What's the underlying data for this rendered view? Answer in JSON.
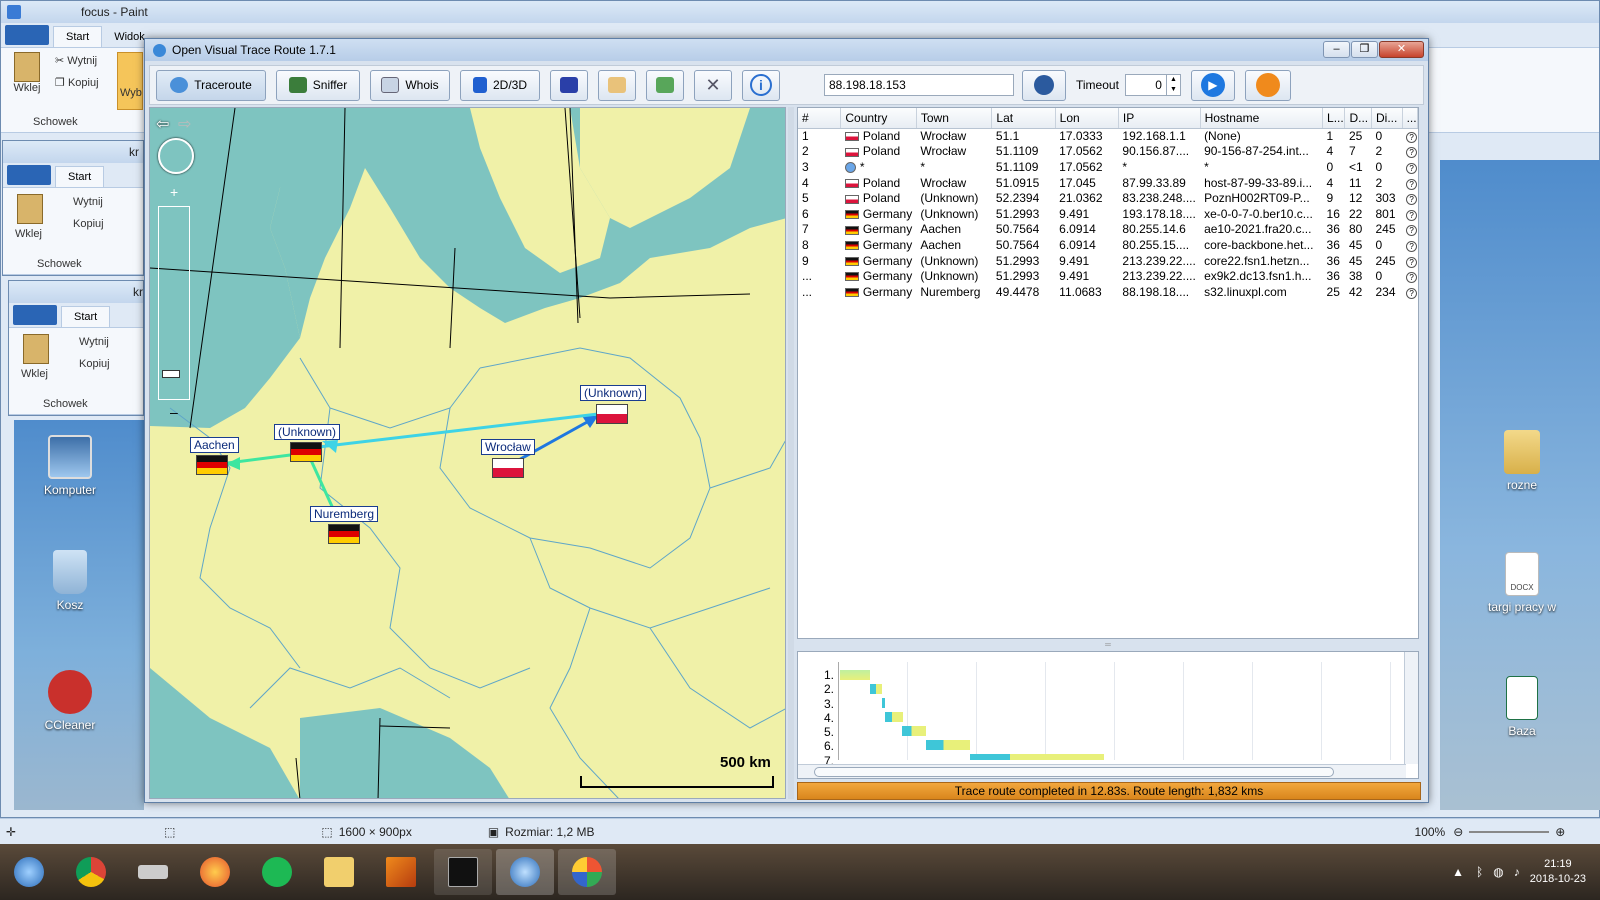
{
  "paint_window": {
    "title": "focus - Paint",
    "tabs": [
      "Start",
      "Widok"
    ],
    "clipboard": {
      "paste": "Wklej",
      "cut": "Wytnij",
      "copy": "Kopiuj",
      "group": "Schowek",
      "select": "Wyb"
    },
    "bg_title_fragment": "kr",
    "status_dimensions": "1600 × 900px",
    "status_size": "Rozmiar: 1,2 MB",
    "zoom": "100%"
  },
  "desktop_icons": [
    {
      "label": "Komputer",
      "icon": "computer-icon"
    },
    {
      "label": "Kosz",
      "icon": "recycle-bin-icon"
    },
    {
      "label": "CCleaner",
      "icon": "ccleaner-icon"
    },
    {
      "label": "rozne",
      "icon": "folder-icon"
    },
    {
      "label": "targi pracy w",
      "icon": "docx-file-icon"
    },
    {
      "label": "Baza",
      "icon": "excel-file-icon"
    }
  ],
  "docx_badge": "DOCX",
  "app": {
    "title": "Open Visual Trace Route 1.7.1",
    "toolbar": {
      "traceroute": "Traceroute",
      "sniffer": "Sniffer",
      "whois": "Whois",
      "view": "2D/3D",
      "ip_value": "88.198.18.153",
      "timeout_label": "Timeout",
      "timeout_value": "0"
    },
    "map": {
      "labels": [
        "(Unknown)",
        "Aachen",
        "(Unknown)",
        "Wrocław",
        "Nuremberg"
      ],
      "scale": "500 km",
      "zoom_plus": "+",
      "zoom_minus": "–"
    },
    "table": {
      "headers": [
        "#",
        "Country",
        "Town",
        "Lat",
        "Lon",
        "IP",
        "Hostname",
        "L...",
        "D...",
        "Di...",
        "..."
      ],
      "rows": [
        {
          "n": "1",
          "flag": "pl",
          "country": "Poland",
          "town": "Wrocław",
          "lat": "51.1",
          "lon": "17.0333",
          "ip": "192.168.1.1",
          "host": "(None)",
          "l": "1",
          "d": "25",
          "di": "0"
        },
        {
          "n": "2",
          "flag": "pl",
          "country": "Poland",
          "town": "Wrocław",
          "lat": "51.1109",
          "lon": "17.0562",
          "ip": "90.156.87....",
          "host": "90-156-87-254.int...",
          "l": "4",
          "d": "7",
          "di": "2"
        },
        {
          "n": "3",
          "flag": "uk",
          "country": "*",
          "town": "*",
          "lat": "51.1109",
          "lon": "17.0562",
          "ip": "*",
          "host": "*",
          "l": "0",
          "d": "<1",
          "di": "0"
        },
        {
          "n": "4",
          "flag": "pl",
          "country": "Poland",
          "town": "Wrocław",
          "lat": "51.0915",
          "lon": "17.045",
          "ip": "87.99.33.89",
          "host": "host-87-99-33-89.i...",
          "l": "4",
          "d": "11",
          "di": "2"
        },
        {
          "n": "5",
          "flag": "pl",
          "country": "Poland",
          "town": "(Unknown)",
          "lat": "52.2394",
          "lon": "21.0362",
          "ip": "83.238.248....",
          "host": "PoznH002RT09-P...",
          "l": "9",
          "d": "12",
          "di": "303"
        },
        {
          "n": "6",
          "flag": "de",
          "country": "Germany",
          "town": "(Unknown)",
          "lat": "51.2993",
          "lon": "9.491",
          "ip": "193.178.18....",
          "host": "xe-0-0-7-0.ber10.c...",
          "l": "16",
          "d": "22",
          "di": "801"
        },
        {
          "n": "7",
          "flag": "de",
          "country": "Germany",
          "town": "Aachen",
          "lat": "50.7564",
          "lon": "6.0914",
          "ip": "80.255.14.6",
          "host": "ae10-2021.fra20.c...",
          "l": "36",
          "d": "80",
          "di": "245"
        },
        {
          "n": "8",
          "flag": "de",
          "country": "Germany",
          "town": "Aachen",
          "lat": "50.7564",
          "lon": "6.0914",
          "ip": "80.255.15....",
          "host": "core-backbone.het...",
          "l": "36",
          "d": "45",
          "di": "0"
        },
        {
          "n": "9",
          "flag": "de",
          "country": "Germany",
          "town": "(Unknown)",
          "lat": "51.2993",
          "lon": "9.491",
          "ip": "213.239.22....",
          "host": "core22.fsn1.hetzn...",
          "l": "36",
          "d": "45",
          "di": "245"
        },
        {
          "n": "...",
          "flag": "de",
          "country": "Germany",
          "town": "(Unknown)",
          "lat": "51.2993",
          "lon": "9.491",
          "ip": "213.239.22....",
          "host": "ex9k2.dc13.fsn1.h...",
          "l": "36",
          "d": "38",
          "di": "0"
        },
        {
          "n": "...",
          "flag": "de",
          "country": "Germany",
          "town": "Nuremberg",
          "lat": "49.4478",
          "lon": "11.0683",
          "ip": "88.198.18....",
          "host": "s32.linuxpl.com",
          "l": "25",
          "d": "42",
          "di": "234"
        }
      ]
    },
    "gantt_rows": [
      "1.",
      "2.",
      "3.",
      "4.",
      "5.",
      "6.",
      "7."
    ],
    "status": "Trace route completed in 12.83s. Route length: 1,832 kms"
  },
  "taskbar": {
    "time": "21:19",
    "date": "2018-10-23"
  }
}
